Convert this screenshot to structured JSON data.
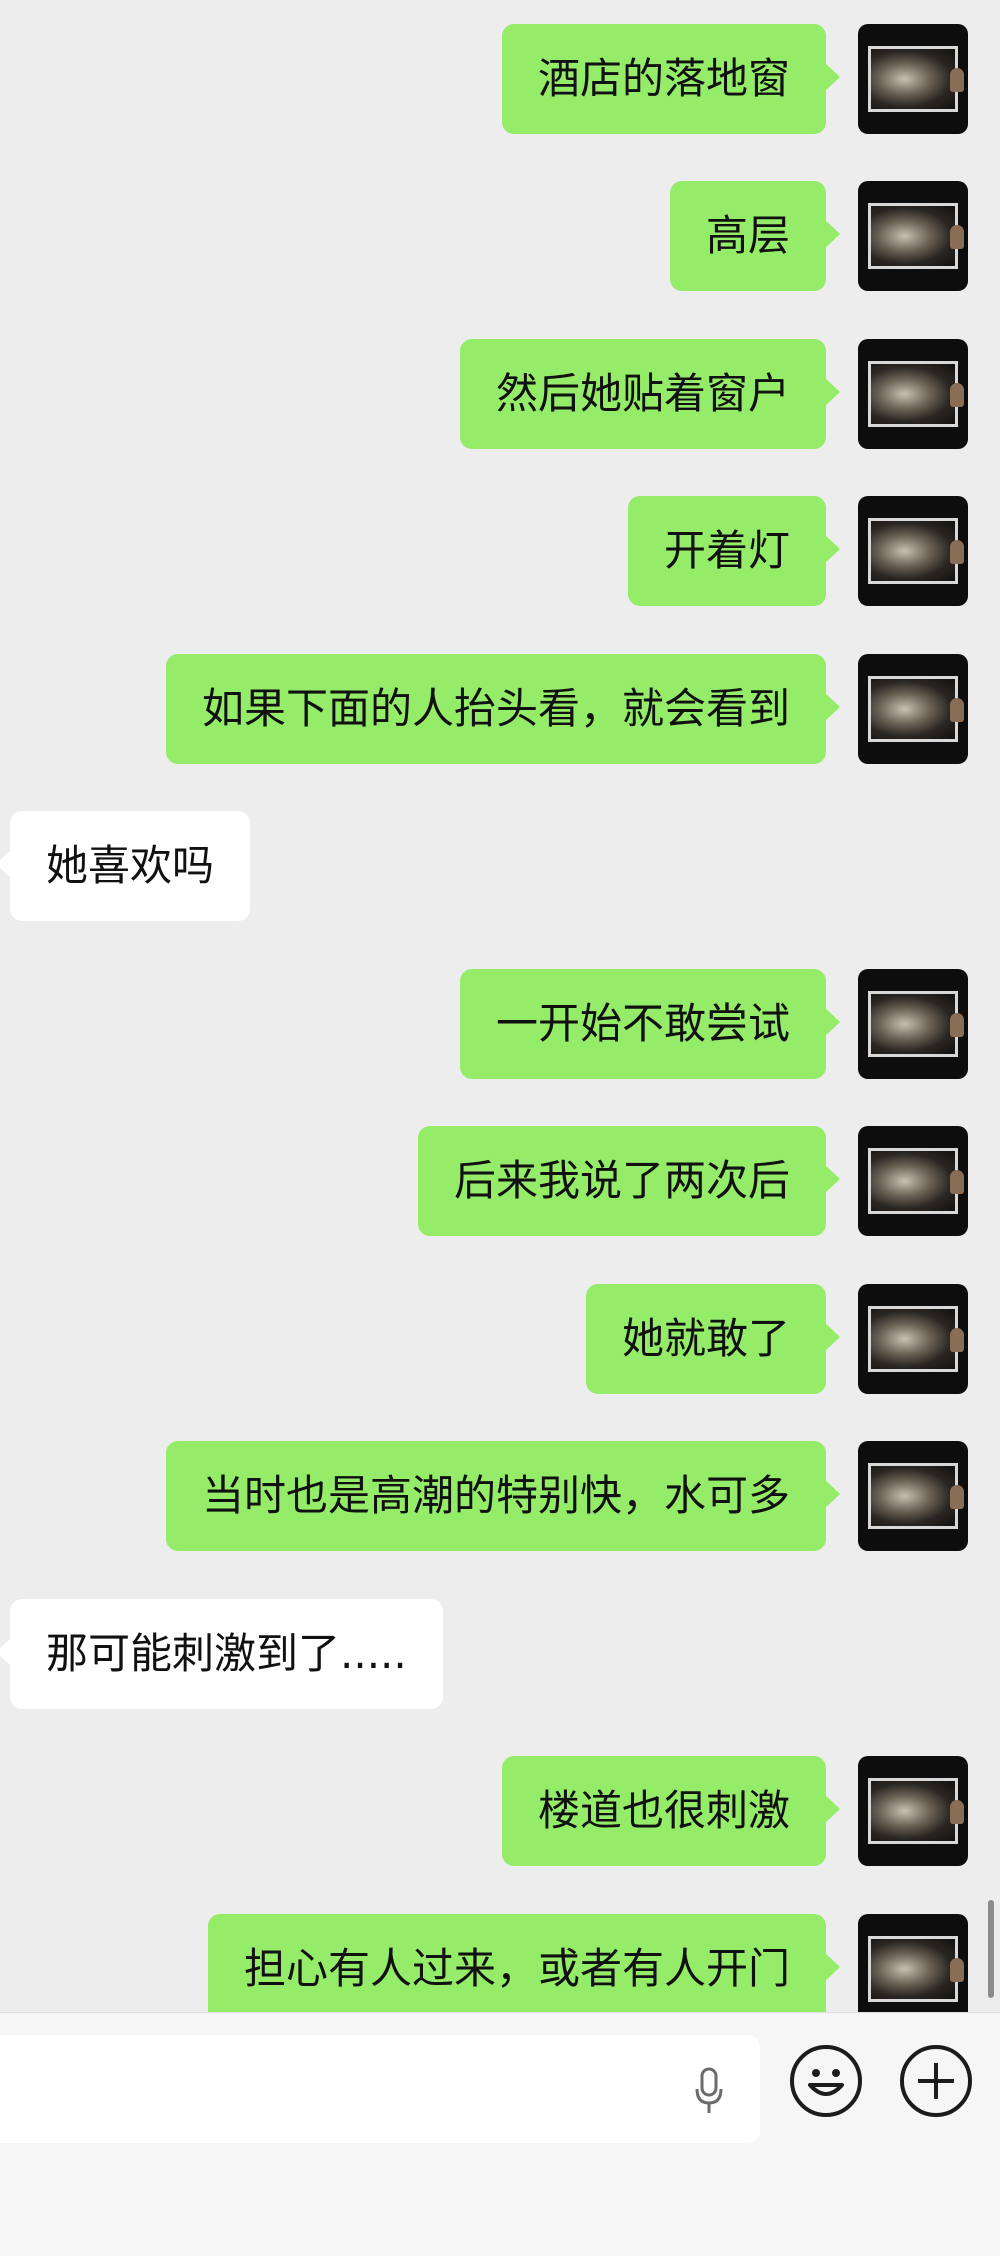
{
  "messages": [
    {
      "side": "right",
      "text": "酒店的落地窗"
    },
    {
      "side": "right",
      "text": "高层"
    },
    {
      "side": "right",
      "text": "然后她贴着窗户"
    },
    {
      "side": "right",
      "text": "开着灯"
    },
    {
      "side": "right",
      "text": "如果下面的人抬头看，就会看到"
    },
    {
      "side": "left",
      "text": "她喜欢吗"
    },
    {
      "side": "right",
      "text": "一开始不敢尝试"
    },
    {
      "side": "right",
      "text": "后来我说了两次后"
    },
    {
      "side": "right",
      "text": "她就敢了"
    },
    {
      "side": "right",
      "text": "当时也是高潮的特别快，水可多"
    },
    {
      "side": "left",
      "text": "那可能刺激到了....."
    },
    {
      "side": "right",
      "text": "楼道也很刺激"
    },
    {
      "side": "right",
      "text": "担心有人过来，或者有人开门"
    }
  ],
  "input": {
    "value": "",
    "placeholder": ""
  },
  "icons": {
    "mic": "microphone-icon",
    "emoji": "emoji-smile-icon",
    "plus": "plus-circle-icon"
  },
  "colors": {
    "outgoing_bubble": "#95ec69",
    "incoming_bubble": "#ffffff",
    "background": "#ededed"
  }
}
